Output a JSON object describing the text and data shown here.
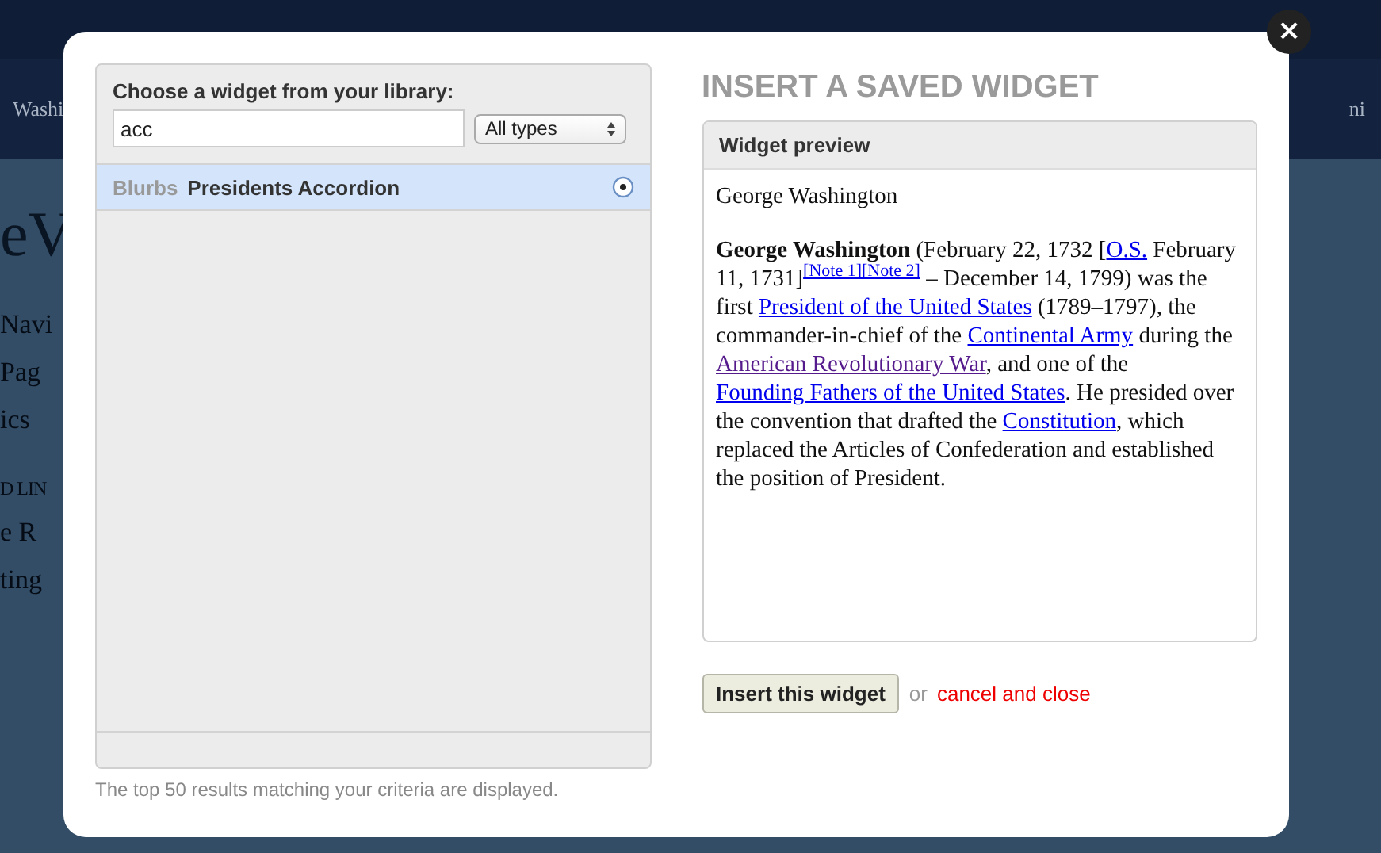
{
  "background_page": {
    "header_left": "Washi",
    "header_right": "ni",
    "title": "eV",
    "nav": [
      "Navi",
      "Pag",
      "ics",
      "D LIN",
      "e R",
      "ting"
    ]
  },
  "library": {
    "heading": "Choose a widget from your library:",
    "search": {
      "value": "acc"
    },
    "type_filter": {
      "value": "All types"
    },
    "results": [
      {
        "type": "Blurbs",
        "name": "Presidents Accordion",
        "selected": true
      }
    ],
    "footnote": "The top 50 results matching your criteria are displayed."
  },
  "insert": {
    "title": "INSERT A SAVED WIDGET",
    "preview": {
      "header": "Widget preview",
      "title": "George Washington",
      "paragraph": [
        {
          "kind": "bold",
          "text": "George Washington"
        },
        {
          "kind": "plain",
          "text": " (February 22, 1732 ["
        },
        {
          "kind": "link",
          "text": "O.S.",
          "visited": false
        },
        {
          "kind": "plain",
          "text": " February 11, 1731]"
        },
        {
          "kind": "note",
          "text": "[Note 1][Note 2]",
          "visited": false
        },
        {
          "kind": "plain",
          "text": " – December 14, 1799) was the first "
        },
        {
          "kind": "link",
          "text": "President of the United States",
          "visited": false
        },
        {
          "kind": "plain",
          "text": " (1789–1797), the commander-in-chief of the "
        },
        {
          "kind": "link",
          "text": "Continental Army",
          "visited": false
        },
        {
          "kind": "plain",
          "text": " during the "
        },
        {
          "kind": "link",
          "text": "American Revolutionary War",
          "visited": true
        },
        {
          "kind": "plain",
          "text": ", and one of the "
        },
        {
          "kind": "link",
          "text": "Founding Fathers of the United States",
          "visited": false
        },
        {
          "kind": "plain",
          "text": ". He presided over the convention that drafted the "
        },
        {
          "kind": "link",
          "text": "Constitution",
          "visited": false
        },
        {
          "kind": "plain",
          "text": ", which replaced the Articles of Confederation and established the position of President."
        }
      ]
    },
    "button": "Insert this widget",
    "or": "or",
    "cancel": "cancel and close"
  },
  "close_button": "×"
}
